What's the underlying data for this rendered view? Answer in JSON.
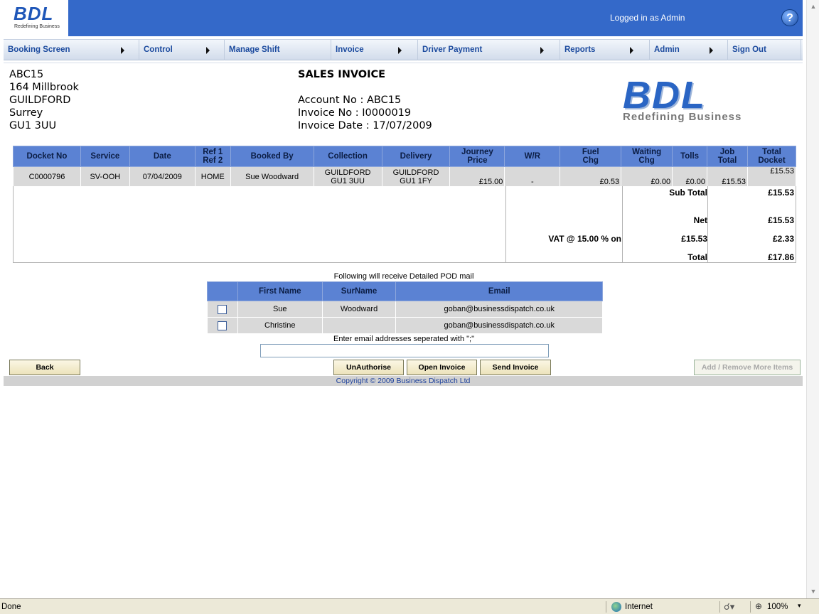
{
  "header": {
    "logo_text": "BDL",
    "logo_tagline": "Redefining Business",
    "logged_in": "Logged in as Admin",
    "help_symbol": "?"
  },
  "nav": [
    {
      "label": "Booking Screen",
      "has_submenu": true
    },
    {
      "label": "Control",
      "has_submenu": true
    },
    {
      "label": "Manage Shift",
      "has_submenu": false
    },
    {
      "label": "Invoice",
      "has_submenu": true
    },
    {
      "label": "Driver Payment",
      "has_submenu": true
    },
    {
      "label": "Reports",
      "has_submenu": true
    },
    {
      "label": "Admin",
      "has_submenu": true
    },
    {
      "label": "Sign Out",
      "has_submenu": false
    }
  ],
  "address": [
    "ABC15",
    "164 Millbrook",
    "GUILDFORD",
    "Surrey",
    "GU1 3UU"
  ],
  "invoice": {
    "title": "SALES INVOICE",
    "account_no": "Account No : ABC15",
    "invoice_no": "Invoice No : I0000019",
    "invoice_date": "Invoice Date : 17/07/2009"
  },
  "table": {
    "headers": {
      "docket_no": "Docket No",
      "service": "Service",
      "date": "Date",
      "ref1": "Ref 1",
      "ref2": "Ref 2",
      "booked_by": "Booked By",
      "collection": "Collection",
      "delivery": "Delivery",
      "journey_price_1": "Journey",
      "journey_price_2": "Price",
      "wr": "W/R",
      "fuel_1": "Fuel",
      "fuel_2": "Chg",
      "waiting_1": "Waiting",
      "waiting_2": "Chg",
      "tolls": "Tolls",
      "job_total_1": "Job",
      "job_total_2": "Total",
      "total_docket_1": "Total",
      "total_docket_2": "Docket"
    },
    "rows": [
      {
        "docket_no": "C0000796",
        "service": "SV-OOH",
        "date": "07/04/2009",
        "ref": "HOME",
        "booked_by": "Sue Woodward",
        "collection_1": "GUILDFORD",
        "collection_2": "GU1 3UU",
        "delivery_1": "GUILDFORD",
        "delivery_2": "GU1 1FY",
        "journey_price": "£15.00",
        "wr": "-",
        "fuel": "£0.53",
        "waiting": "£0.00",
        "tolls": "£0.00",
        "job_total": "£15.53",
        "total_docket": "£15.53"
      }
    ]
  },
  "totals": {
    "subtotal_label": "Sub Total",
    "subtotal_value": "£15.53",
    "net_label": "Net",
    "net_value": "£15.53",
    "vat_label": "VAT @ 15.00 % on",
    "vat_base": "£15.53",
    "vat_value": "£2.33",
    "total_label": "Total",
    "total_value": "£17.86"
  },
  "pod": {
    "caption": "Following will receive Detailed POD mail",
    "headers": {
      "first_name": "First Name",
      "surname": "SurName",
      "email": "Email"
    },
    "rows": [
      {
        "first_name": "Sue",
        "surname": "Woodward",
        "email": "goban@businessdispatch.co.uk"
      },
      {
        "first_name": "Christine",
        "surname": "",
        "email": "goban@businessdispatch.co.uk"
      }
    ],
    "email_caption": "Enter email addresses seperated with \";\"",
    "email_value": ""
  },
  "buttons": {
    "back": "Back",
    "unauthorise": "UnAuthorise",
    "open_invoice": "Open Invoice",
    "send_invoice": "Send Invoice",
    "add_remove": "Add / Remove More Items"
  },
  "footer": {
    "copyright": "Copyright © 2009 Business Dispatch Ltd"
  },
  "statusbar": {
    "status": "Done",
    "zone": "Internet",
    "zoom": "100%"
  },
  "colors": {
    "header_bg": "#3469c9",
    "table_header_bg": "#5b82d3",
    "row_bg": "#d9d9d9",
    "nav_text": "#1b4a9e"
  }
}
